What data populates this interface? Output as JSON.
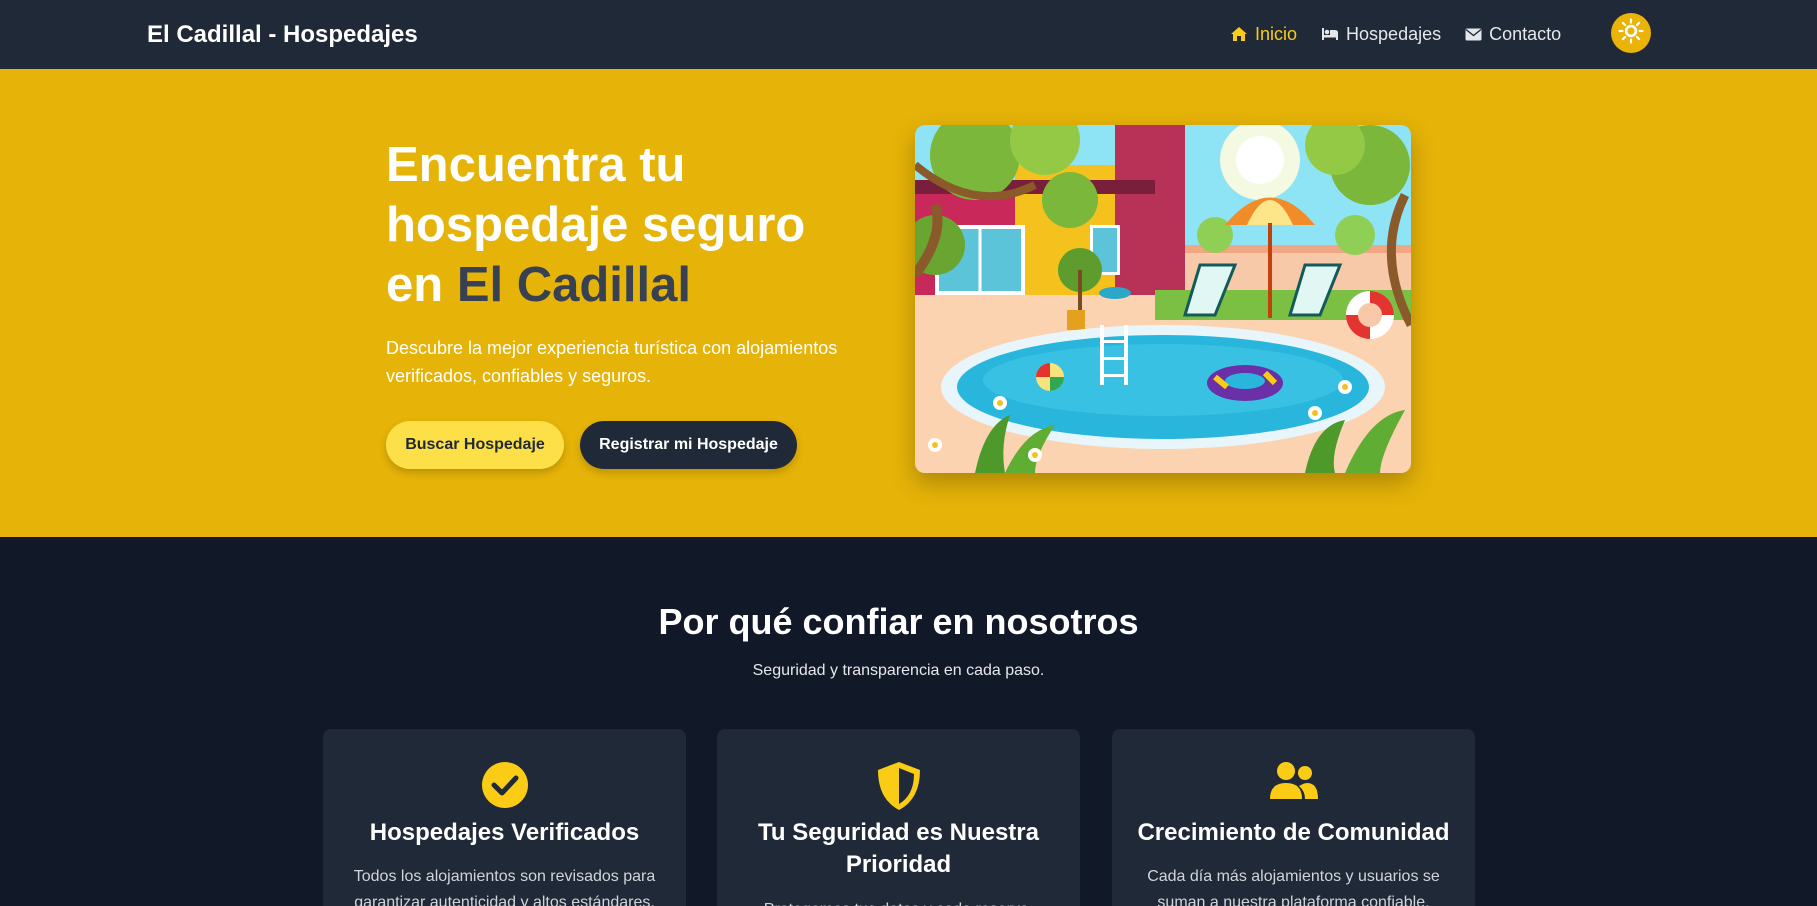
{
  "nav": {
    "brand": "El Cadillal - Hospedajes",
    "links": [
      {
        "label": "Inicio",
        "icon": "home-icon",
        "active": true
      },
      {
        "label": "Hospedajes",
        "icon": "bed-icon",
        "active": false
      },
      {
        "label": "Contacto",
        "icon": "envelope-icon",
        "active": false
      }
    ],
    "theme_toggle_icon": "sun-icon"
  },
  "hero": {
    "title_part1": "Encuentra tu hospedaje seguro en",
    "title_accent": "El Cadillal",
    "description": "Descubre la mejor experiencia turística con alojamientos verificados, confiables y seguros.",
    "primary_button": "Buscar Hospedaje",
    "secondary_button": "Registrar mi Hospedaje",
    "image_icon": "pool-illustration"
  },
  "features": {
    "title": "Por qué confiar en nosotros",
    "subtitle": "Seguridad y transparencia en cada paso.",
    "cards": [
      {
        "icon": "check-circle-icon",
        "title": "Hospedajes Verificados",
        "text": "Todos los alojamientos son revisados para garantizar autenticidad y altos estándares."
      },
      {
        "icon": "shield-icon",
        "title": "Tu Seguridad es Nuestra Prioridad",
        "text": "Protegemos tus datos y cada reserva."
      },
      {
        "icon": "users-icon",
        "title": "Crecimiento de Comunidad",
        "text": "Cada día más alojamientos y usuarios se suman a nuestra plataforma confiable."
      }
    ]
  },
  "colors": {
    "navbar": "#1f2937",
    "hero_bg": "#e6b308",
    "accent_yellow": "#facc15",
    "dark_bg": "#111827",
    "card_bg": "#1f2937"
  }
}
